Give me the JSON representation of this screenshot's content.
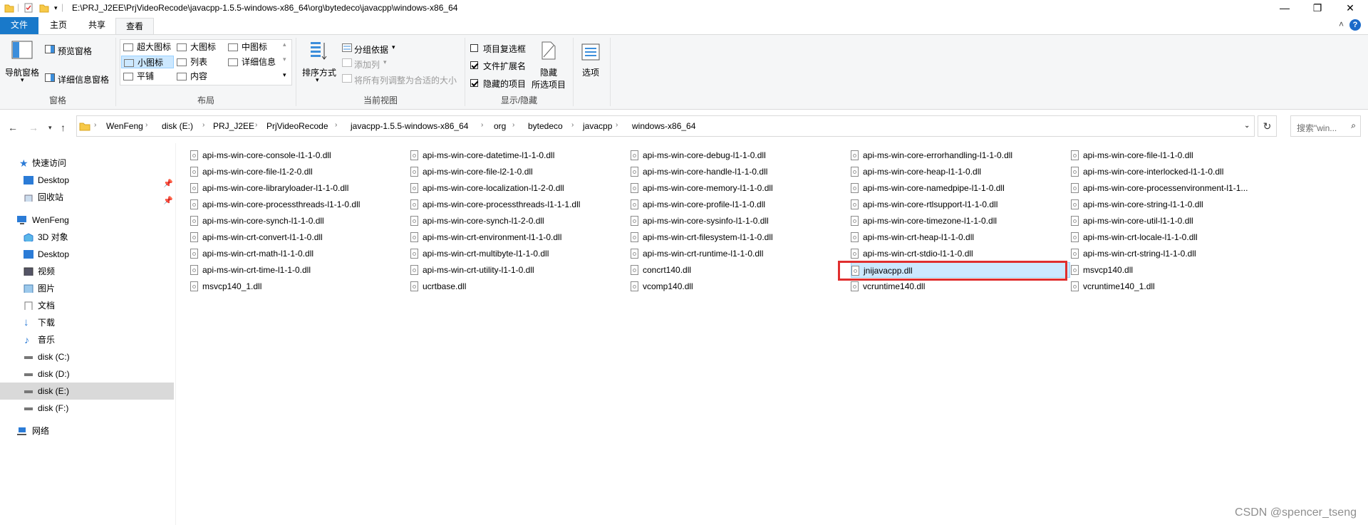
{
  "window": {
    "title": "E:\\PRJ_J2EE\\PrjVideoRecode\\javacpp-1.5.5-windows-x86_64\\org\\bytedeco\\javacpp\\windows-x86_64",
    "minimize": "—",
    "maximize": "❐",
    "close": "✕"
  },
  "tabs": {
    "file": "文件",
    "home": "主页",
    "share": "共享",
    "view": "查看"
  },
  "ribbon": {
    "panes": {
      "nav_pane": "导航窗格",
      "preview": "预览窗格",
      "details": "详细信息窗格",
      "title": "窗格"
    },
    "layout": {
      "items": [
        "超大图标",
        "大图标",
        "中图标",
        "小图标",
        "列表",
        "详细信息",
        "平铺",
        "内容"
      ],
      "selected": "小图标",
      "title": "布局"
    },
    "current_view": {
      "sort": "排序方式",
      "group_by": "分组依据",
      "add_columns": "添加列",
      "fit_columns": "将所有列调整为合适的大小",
      "title": "当前视图"
    },
    "show_hide": {
      "item_checkboxes": "项目复选框",
      "item_checkboxes_checked": false,
      "file_ext": "文件扩展名",
      "file_ext_checked": true,
      "hidden_items": "隐藏的项目",
      "hidden_items_checked": true,
      "hide_selected_line1": "隐藏",
      "hide_selected_line2": "所选项目",
      "title": "显示/隐藏"
    },
    "options": "选项"
  },
  "breadcrumb": [
    "WenFeng",
    "disk (E:)",
    "PRJ_J2EE",
    "PrjVideoRecode",
    "javacpp-1.5.5-windows-x86_64",
    "org",
    "bytedeco",
    "javacpp",
    "windows-x86_64"
  ],
  "search": {
    "placeholder": "搜索\"win..."
  },
  "nav": {
    "quick_access": "快速访问",
    "qa_desktop": "Desktop",
    "qa_recycle": "回收站",
    "this_pc": "WenFeng",
    "objects3d": "3D 对象",
    "desktop": "Desktop",
    "videos": "视频",
    "pictures": "图片",
    "documents": "文档",
    "downloads": "下载",
    "music": "音乐",
    "disk_c": "disk (C:)",
    "disk_d": "disk (D:)",
    "disk_e": "disk (E:)",
    "disk_f": "disk (F:)",
    "network": "网络"
  },
  "files": [
    "api-ms-win-core-console-l1-1-0.dll",
    "api-ms-win-core-datetime-l1-1-0.dll",
    "api-ms-win-core-debug-l1-1-0.dll",
    "api-ms-win-core-errorhandling-l1-1-0.dll",
    "api-ms-win-core-file-l1-1-0.dll",
    "api-ms-win-core-file-l1-2-0.dll",
    "api-ms-win-core-file-l2-1-0.dll",
    "api-ms-win-core-handle-l1-1-0.dll",
    "api-ms-win-core-heap-l1-1-0.dll",
    "api-ms-win-core-interlocked-l1-1-0.dll",
    "api-ms-win-core-libraryloader-l1-1-0.dll",
    "api-ms-win-core-localization-l1-2-0.dll",
    "api-ms-win-core-memory-l1-1-0.dll",
    "api-ms-win-core-namedpipe-l1-1-0.dll",
    "api-ms-win-core-processenvironment-l1-1...",
    "api-ms-win-core-processthreads-l1-1-0.dll",
    "api-ms-win-core-processthreads-l1-1-1.dll",
    "api-ms-win-core-profile-l1-1-0.dll",
    "api-ms-win-core-rtlsupport-l1-1-0.dll",
    "api-ms-win-core-string-l1-1-0.dll",
    "api-ms-win-core-synch-l1-1-0.dll",
    "api-ms-win-core-synch-l1-2-0.dll",
    "api-ms-win-core-sysinfo-l1-1-0.dll",
    "api-ms-win-core-timezone-l1-1-0.dll",
    "api-ms-win-core-util-l1-1-0.dll",
    "api-ms-win-crt-convert-l1-1-0.dll",
    "api-ms-win-crt-environment-l1-1-0.dll",
    "api-ms-win-crt-filesystem-l1-1-0.dll",
    "api-ms-win-crt-heap-l1-1-0.dll",
    "api-ms-win-crt-locale-l1-1-0.dll",
    "api-ms-win-crt-math-l1-1-0.dll",
    "api-ms-win-crt-multibyte-l1-1-0.dll",
    "api-ms-win-crt-runtime-l1-1-0.dll",
    "api-ms-win-crt-stdio-l1-1-0.dll",
    "api-ms-win-crt-string-l1-1-0.dll",
    "api-ms-win-crt-time-l1-1-0.dll",
    "api-ms-win-crt-utility-l1-1-0.dll",
    "concrt140.dll",
    "jnijavacpp.dll",
    "msvcp140.dll",
    "msvcp140_1.dll",
    "ucrtbase.dll",
    "vcomp140.dll",
    "vcruntime140.dll",
    "vcruntime140_1.dll"
  ],
  "selected_file": "jnijavacpp.dll",
  "watermark": "CSDN @spencer_tseng",
  "colors": {
    "accent": "#1979ca",
    "selection": "#cce8ff",
    "highlight_box": "#e02e2e"
  }
}
